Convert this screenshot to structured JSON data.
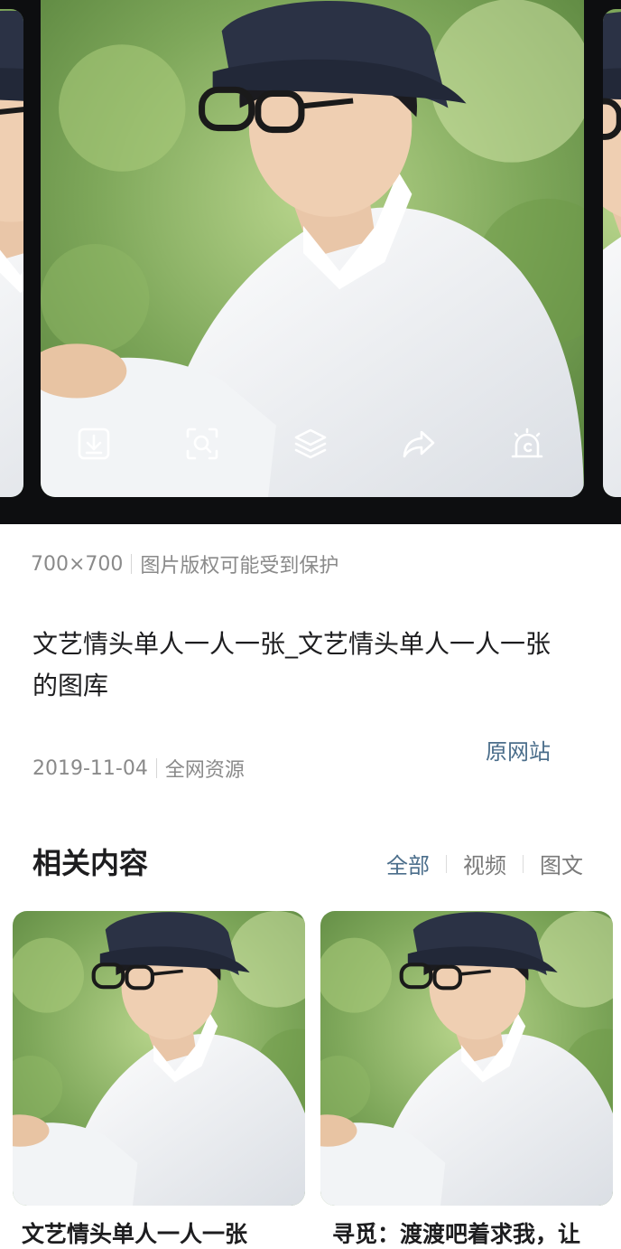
{
  "viewer": {
    "toolbar": [
      {
        "name": "download-icon"
      },
      {
        "name": "scan-search-icon"
      },
      {
        "name": "layers-icon"
      },
      {
        "name": "share-icon"
      },
      {
        "name": "alarm-report-icon"
      }
    ]
  },
  "meta": {
    "dimensions": "700×700",
    "copyright": "图片版权可能受到保护"
  },
  "title": "文艺情头单人一人一张_文艺情头单人一人一张的图库",
  "date": "2019-11-04",
  "source_type": "全网资源",
  "source_link": "原网站",
  "related": {
    "heading": "相关内容",
    "tabs": [
      "全部",
      "视频",
      "图文"
    ],
    "active_tab": "全部",
    "cards": [
      {
        "caption": "文艺情头单人一人一张"
      },
      {
        "caption": "寻觅：渡渡吧着求我，让"
      }
    ]
  },
  "colors": {
    "accent": "#4b6e8b",
    "viewer_bg": "#0d0e10"
  }
}
